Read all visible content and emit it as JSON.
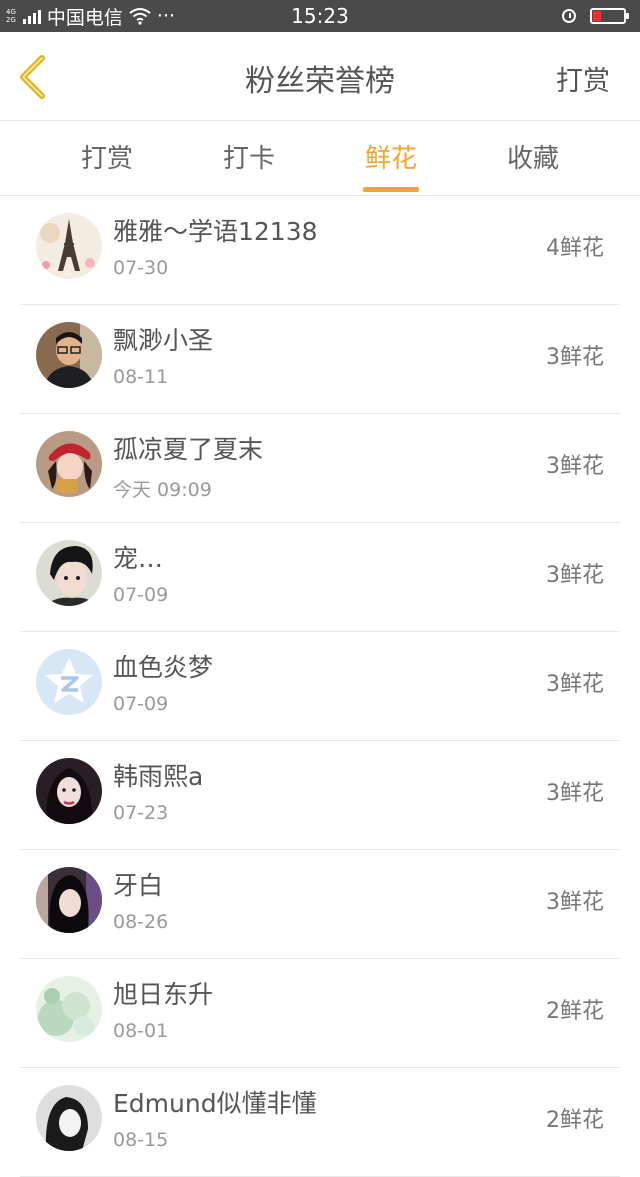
{
  "status_bar": {
    "net_top": "4G",
    "net_bottom": "2G",
    "carrier": "中国电信",
    "dots": "···",
    "time": "15:23",
    "icons": [
      "signal-icon",
      "wifi-icon",
      "alarm-icon",
      "battery-icon"
    ],
    "battery_color": "#ff2a2a"
  },
  "nav": {
    "title": "粉丝荣誉榜",
    "action_label": "打赏",
    "back_icon": "chevron-left-icon",
    "back_icon_color": "#e4b21a"
  },
  "tabs": [
    {
      "label": "打赏",
      "active": false
    },
    {
      "label": "打卡",
      "active": false
    },
    {
      "label": "鲜花",
      "active": true
    },
    {
      "label": "收藏",
      "active": false
    }
  ],
  "accent_color": "#f2a52e",
  "list": [
    {
      "name": "雅雅～学语12138",
      "date": "07-30",
      "amount": "4鲜花",
      "avatar": "eiffel-tower-avatar"
    },
    {
      "name": "飘渺小圣",
      "date": "08-11",
      "amount": "3鲜花",
      "avatar": "man-with-glasses-avatar"
    },
    {
      "name": "孤凉夏了夏末",
      "date": "今天 09:09",
      "amount": "3鲜花",
      "avatar": "girl-red-hat-avatar"
    },
    {
      "name": "宠…",
      "date": "07-09",
      "amount": "3鲜花",
      "avatar": "boy-portrait-avatar"
    },
    {
      "name": "血色炎梦",
      "date": "07-09",
      "amount": "3鲜花",
      "avatar": "default-qzone-avatar"
    },
    {
      "name": "韩雨熙a",
      "date": "07-23",
      "amount": "3鲜花",
      "avatar": "girl-portrait-avatar"
    },
    {
      "name": "牙白",
      "date": "08-26",
      "amount": "3鲜花",
      "avatar": "girl-dark-hair-avatar"
    },
    {
      "name": "旭日东升",
      "date": "08-01",
      "amount": "2鲜花",
      "avatar": "watercolor-avatar"
    },
    {
      "name": "Edmund似懂非懂",
      "date": "08-15",
      "amount": "2鲜花",
      "avatar": "bw-portrait-avatar"
    }
  ]
}
